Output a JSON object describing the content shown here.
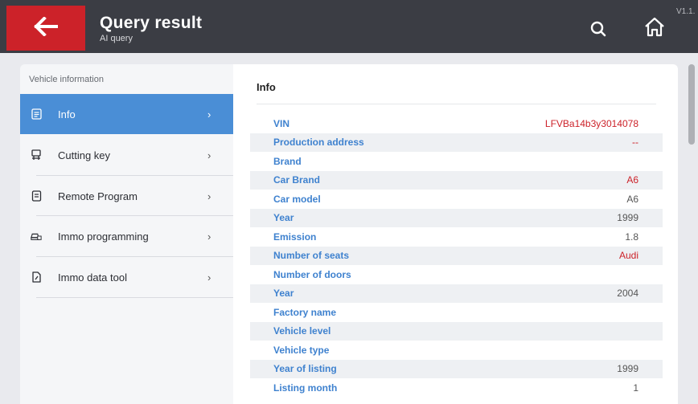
{
  "header": {
    "title": "Query result",
    "subtitle": "AI query",
    "version": "V1.1.",
    "back_icon": "arrow-left-icon",
    "search_icon": "search-icon",
    "home_icon": "home-icon"
  },
  "sidebar": {
    "heading": "Vehicle information",
    "items": [
      {
        "label": "Info",
        "icon": "document-icon",
        "active": true
      },
      {
        "label": "Cutting key",
        "icon": "key-cutter-icon",
        "active": false
      },
      {
        "label": "Remote Program",
        "icon": "remote-icon",
        "active": false
      },
      {
        "label": "Immo programming",
        "icon": "car-lock-icon",
        "active": false
      },
      {
        "label": "Immo data tool",
        "icon": "tool-icon",
        "active": false
      }
    ]
  },
  "panel": {
    "title": "Info",
    "rows": [
      {
        "key": "VIN",
        "value": "LFVBa14b3y3014078",
        "highlight": true
      },
      {
        "key": "Production address",
        "value": "--",
        "highlight": true
      },
      {
        "key": "Brand",
        "value": "",
        "highlight": false
      },
      {
        "key": "Car Brand",
        "value": "A6",
        "highlight": true
      },
      {
        "key": "Car model",
        "value": "A6",
        "highlight": false
      },
      {
        "key": "Year",
        "value": "1999",
        "highlight": false
      },
      {
        "key": "Emission",
        "value": "1.8",
        "highlight": false
      },
      {
        "key": "Number of seats",
        "value": "Audi",
        "highlight": true
      },
      {
        "key": "Number of doors",
        "value": "",
        "highlight": false
      },
      {
        "key": "Year",
        "value": "2004",
        "highlight": false
      },
      {
        "key": "Factory name",
        "value": "",
        "highlight": false
      },
      {
        "key": "Vehicle level",
        "value": "",
        "highlight": false
      },
      {
        "key": "Vehicle type",
        "value": "",
        "highlight": false
      },
      {
        "key": "Year of listing",
        "value": "1999",
        "highlight": false
      },
      {
        "key": "Listing month",
        "value": "1",
        "highlight": false
      }
    ]
  },
  "colors": {
    "header_bg": "#3b3d44",
    "back_button": "#cc2229",
    "active_menu": "#4a8ed6",
    "key_text": "#3f82cf",
    "red_value": "#cc2229"
  }
}
